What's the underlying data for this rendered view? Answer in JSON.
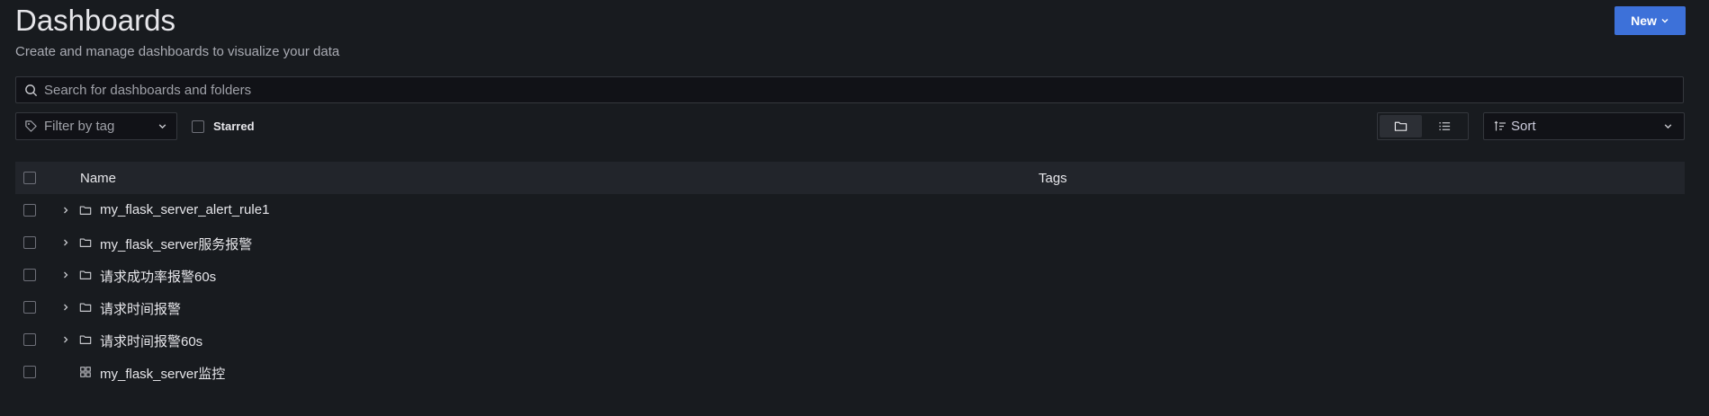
{
  "header": {
    "title": "Dashboards",
    "subtitle": "Create and manage dashboards to visualize your data",
    "new_label": "New"
  },
  "search": {
    "placeholder": "Search for dashboards and folders",
    "value": ""
  },
  "filters": {
    "tag_label": "Filter by tag",
    "starred_label": "Starred",
    "starred_checked": false,
    "view_mode": "folders",
    "sort_label": "Sort"
  },
  "table": {
    "columns": [
      "Name",
      "Tags"
    ],
    "rows": [
      {
        "name": "my_flask_server_alert_rule1",
        "type": "folder",
        "icon": "folder-icon",
        "tags": ""
      },
      {
        "name": "my_flask_server服务报警",
        "type": "folder",
        "icon": "folder-icon",
        "tags": ""
      },
      {
        "name": "请求成功率报警60s",
        "type": "folder",
        "icon": "folder-icon",
        "tags": ""
      },
      {
        "name": "请求时间报警",
        "type": "folder",
        "icon": "folder-icon",
        "tags": ""
      },
      {
        "name": "请求时间报警60s",
        "type": "folder",
        "icon": "folder-icon",
        "tags": ""
      },
      {
        "name": "my_flask_server监控",
        "type": "dashboard",
        "icon": "dashboard-grid-icon",
        "tags": ""
      }
    ]
  },
  "colors": {
    "background": "#181b1f",
    "primary_button": "#3d71d9",
    "header_row": "#22252b",
    "text": "#e6e6ea"
  }
}
